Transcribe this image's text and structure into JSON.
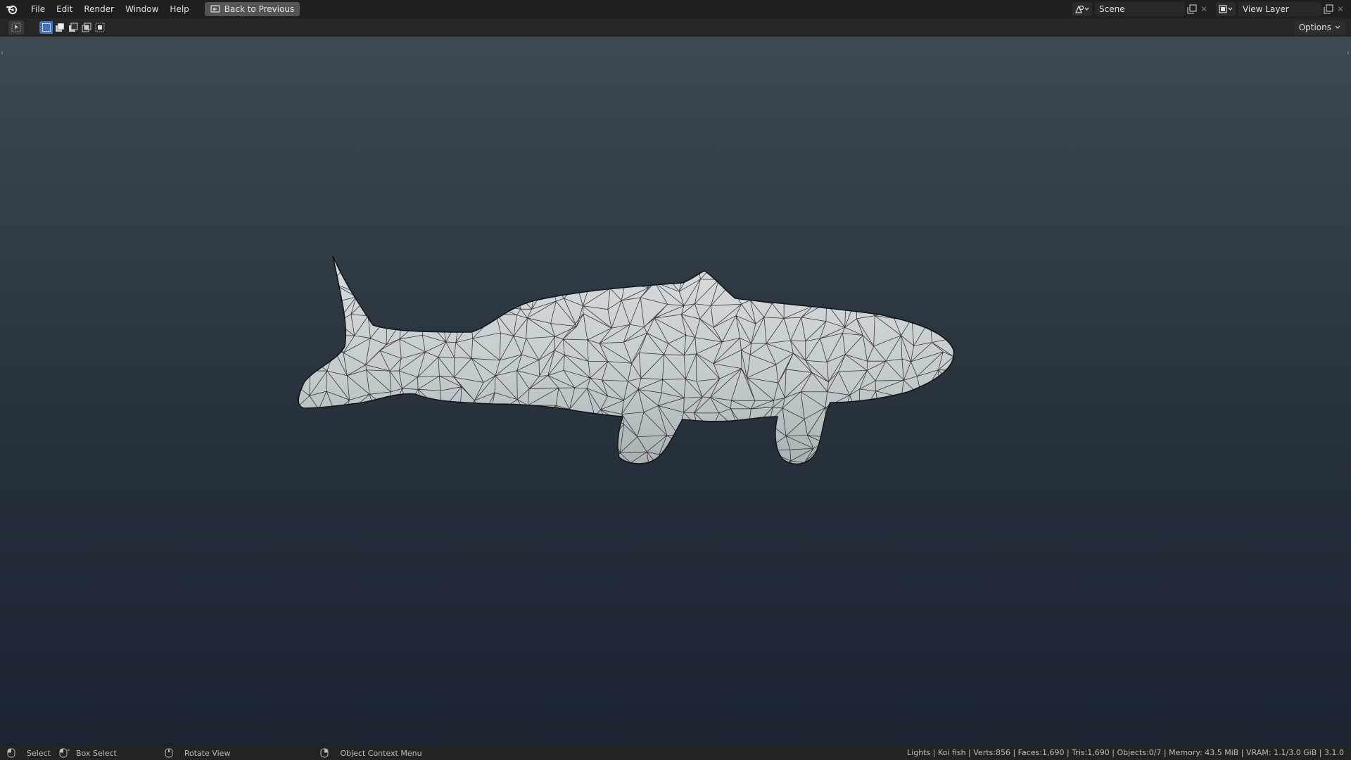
{
  "menu": {
    "items": [
      "File",
      "Edit",
      "Render",
      "Window",
      "Help"
    ],
    "back_label": "Back to Previous"
  },
  "scene": {
    "name": "Scene"
  },
  "view_layer": {
    "name": "View Layer"
  },
  "toolbar": {
    "options_label": "Options"
  },
  "status": {
    "select_label": "Select",
    "box_select_label": "Box Select",
    "rotate_label": "Rotate View",
    "context_label": "Object Context Menu",
    "stats": "Lights | Koi fish | Verts:856 | Faces:1,690 | Tris:1,690 | Objects:0/7 | Memory: 43.5 MiB | VRAM: 1.1/3.0 GiB | 3.1.0"
  },
  "colors": {
    "accent": "#4772b3",
    "topbar": "#1f1f1f",
    "viewport_top": "#3d4a52",
    "viewport_bottom": "#1b2330",
    "mesh_fill": "#c9d0d4",
    "wire": "#1a1a1a"
  },
  "icons": {
    "logo": "blender-logo-icon",
    "back": "back-to-previous-icon",
    "scene": "scene-icon",
    "view_layer": "view-layer-icon"
  }
}
